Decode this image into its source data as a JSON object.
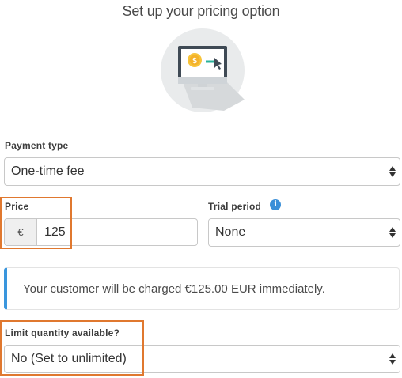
{
  "page": {
    "title": "Set up your pricing option"
  },
  "payment_type": {
    "label": "Payment type",
    "selected": "One-time fee"
  },
  "price": {
    "label": "Price",
    "currency_symbol": "€",
    "value": "125"
  },
  "trial_period": {
    "label": "Trial period",
    "info_icon_glyph": "i",
    "selected": "None"
  },
  "charge_notice": {
    "text": "Your customer will be charged €125.00 EUR immediately."
  },
  "limit_quantity": {
    "label": "Limit quantity available?",
    "selected": "No (Set to unlimited)"
  },
  "icons": {
    "hero": "computer-payment-icon",
    "select_arrows": "chevron-up-down-icon",
    "info": "info-icon"
  },
  "colors": {
    "highlight": "#e0782f",
    "alert_accent": "#3a96dd",
    "info_icon": "#3a8fd8"
  }
}
